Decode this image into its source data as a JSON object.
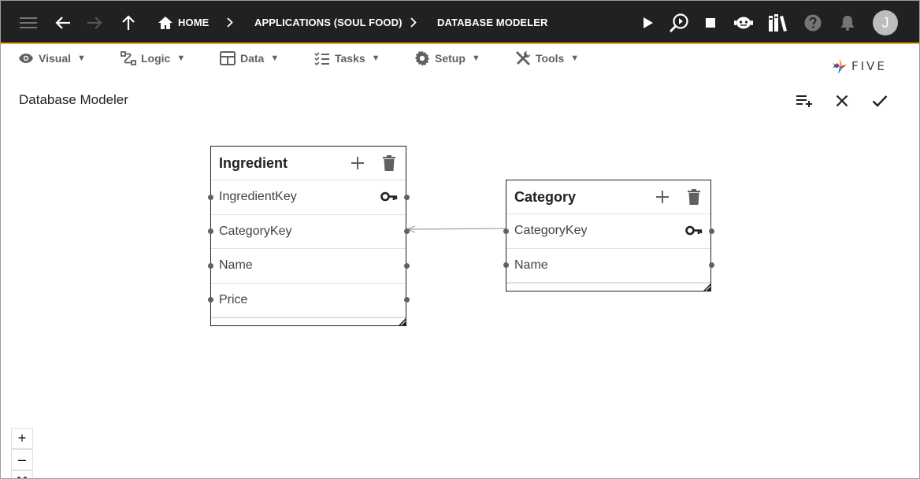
{
  "topbar": {
    "breadcrumbs": [
      "HOME",
      "APPLICATIONS (SOUL FOOD)",
      "DATABASE MODELER"
    ],
    "avatar_letter": "J",
    "icons": [
      "menu-icon",
      "back-arrow-icon",
      "forward-arrow-icon",
      "up-arrow-icon",
      "home-icon",
      "chevron-right-icon",
      "play-icon",
      "search-debug-icon",
      "stop-icon",
      "chat-bot-icon",
      "library-icon",
      "help-icon",
      "bell-icon"
    ]
  },
  "menu": {
    "items": [
      {
        "label": "Visual",
        "icon": "eye-icon"
      },
      {
        "label": "Logic",
        "icon": "logic-icon"
      },
      {
        "label": "Data",
        "icon": "table-icon"
      },
      {
        "label": "Tasks",
        "icon": "tasks-icon"
      },
      {
        "label": "Setup",
        "icon": "gear-icon"
      },
      {
        "label": "Tools",
        "icon": "tools-icon"
      }
    ],
    "caret": "▼",
    "logo_text": "FIVE"
  },
  "page": {
    "title": "Database Modeler",
    "actions": [
      "add-list-icon",
      "close-icon",
      "check-icon"
    ]
  },
  "tables": [
    {
      "name": "Ingredient",
      "fields": [
        {
          "name": "IngredientKey",
          "primary_key": true
        },
        {
          "name": "CategoryKey",
          "primary_key": false
        },
        {
          "name": "Name",
          "primary_key": false
        },
        {
          "name": "Price",
          "primary_key": false
        }
      ]
    },
    {
      "name": "Category",
      "fields": [
        {
          "name": "CategoryKey",
          "primary_key": true
        },
        {
          "name": "Name",
          "primary_key": false
        }
      ]
    }
  ],
  "zoom": {
    "in": "+",
    "out": "–"
  },
  "colors": {
    "topbar_bg": "#212121",
    "accent": "#f5a623",
    "menu_text": "#616161"
  }
}
